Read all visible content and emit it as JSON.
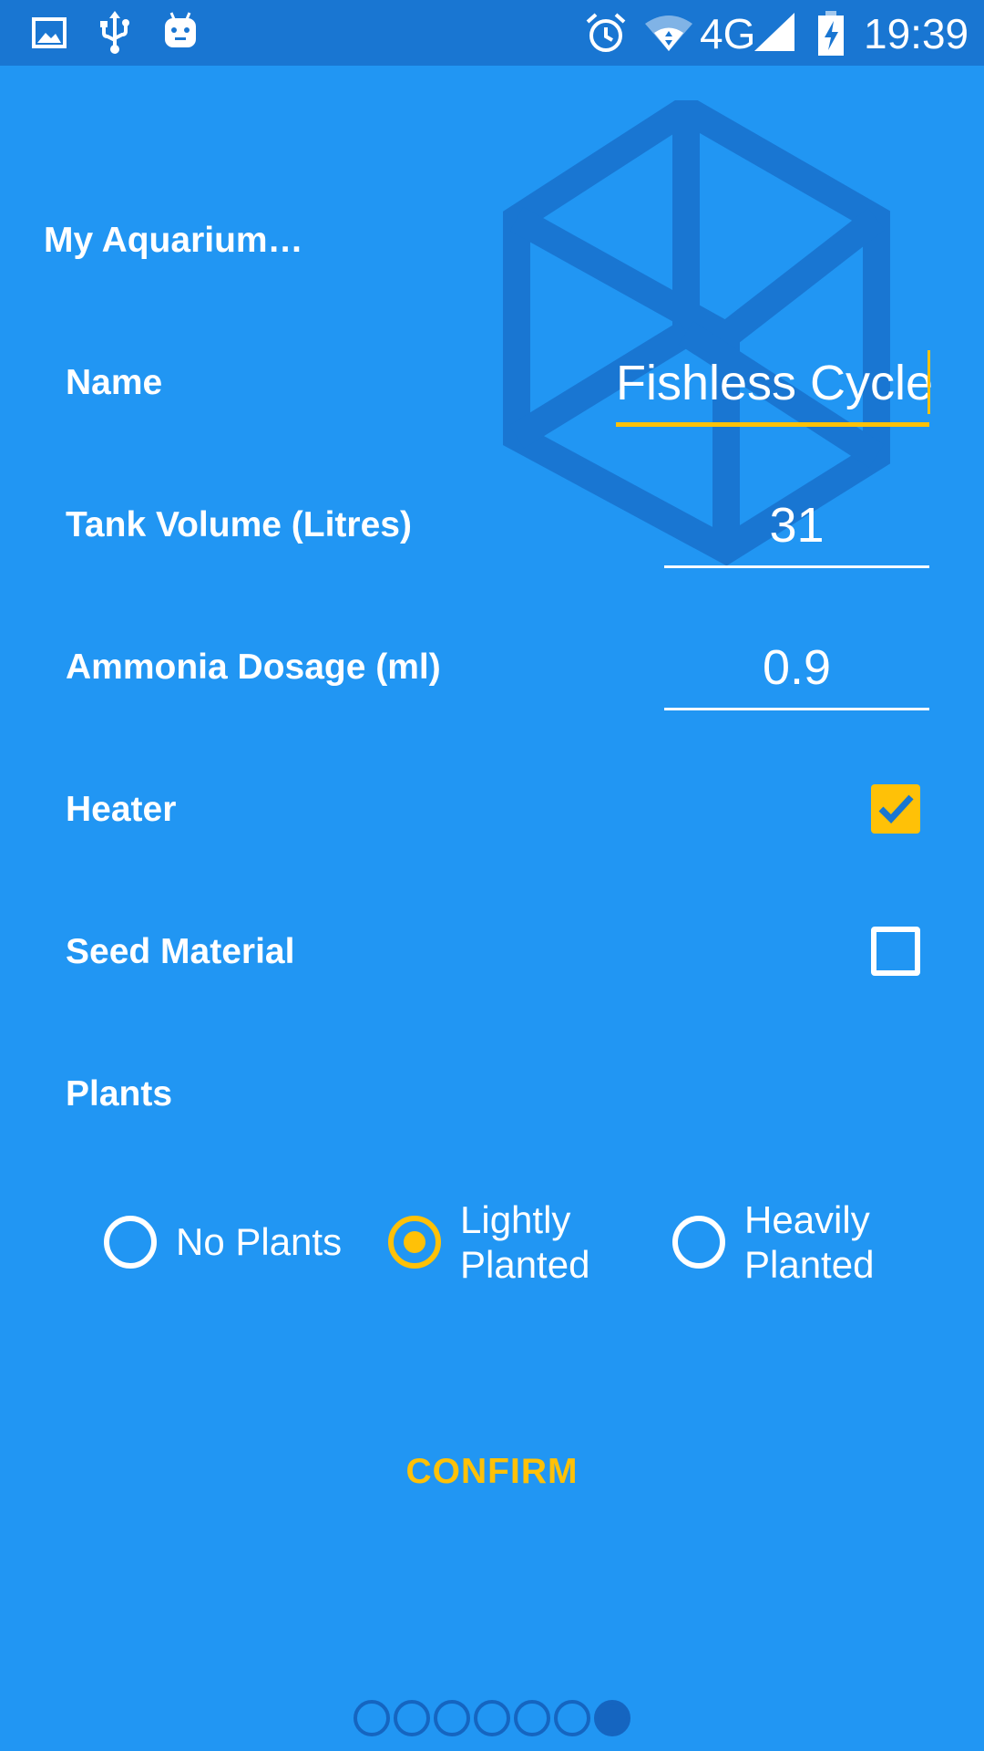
{
  "status_bar": {
    "time": "19:39",
    "network": "4G",
    "left_icons": [
      "image-icon",
      "usb-icon",
      "android-icon"
    ],
    "right_icons": [
      "alarm-icon",
      "wifi-icon",
      "signal-icon",
      "battery-charging-icon"
    ]
  },
  "page": {
    "title": "My Aquarium…",
    "background_icon": "cube-icon"
  },
  "fields": {
    "name": {
      "label": "Name",
      "value": "Fishless Cycle"
    },
    "tank_volume": {
      "label": "Tank Volume (Litres)",
      "value": "31"
    },
    "ammonia_dosage": {
      "label": "Ammonia Dosage (ml)",
      "value": "0.9"
    },
    "heater": {
      "label": "Heater",
      "checked": true
    },
    "seed_material": {
      "label": "Seed Material",
      "checked": false
    },
    "plants": {
      "label": "Plants",
      "options": [
        {
          "label": "No Plants",
          "selected": false
        },
        {
          "label_line1": "Lightly",
          "label_line2": "Planted",
          "selected": true
        },
        {
          "label_line1": "Heavily",
          "label_line2": "Planted",
          "selected": false
        }
      ]
    }
  },
  "confirm_label": "CONFIRM",
  "pager": {
    "total": 7,
    "current": 7
  },
  "colors": {
    "background": "#2196F3",
    "status_bar": "#1976D2",
    "accent": "#FFC107",
    "cube": "#1976D2",
    "pager": "#1565C0"
  }
}
